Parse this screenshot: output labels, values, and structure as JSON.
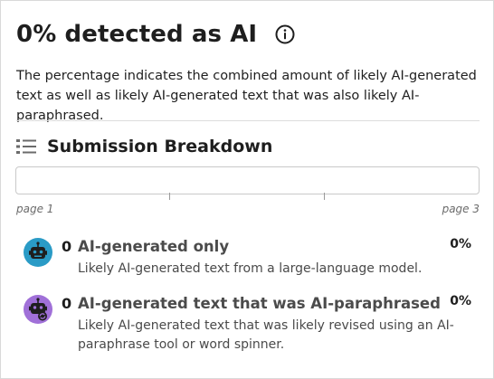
{
  "header": {
    "title": "0% detected as AI",
    "info_icon": "info-circle-icon"
  },
  "description": "The percentage indicates the combined amount of likely AI-generated text as well as likely AI-generated text that was also likely AI-paraphrased.",
  "breakdown": {
    "section_icon": "list-icon",
    "title": "Submission Breakdown",
    "page_start_label": "page 1",
    "page_end_label": "page 3"
  },
  "items": [
    {
      "icon": "robot-icon",
      "icon_color": "#2a9bc6",
      "count": "0",
      "title": "AI-generated only",
      "description": "Likely AI-generated text from a large-language model.",
      "percent": "0%"
    },
    {
      "icon": "robot-paraphrase-icon",
      "icon_color": "#a070d8",
      "count": "0",
      "title": "AI-generated text that was AI-paraphrased",
      "description": "Likely AI-generated text that was likely revised using an AI-paraphrase tool or word spinner.",
      "percent": "0%"
    }
  ]
}
